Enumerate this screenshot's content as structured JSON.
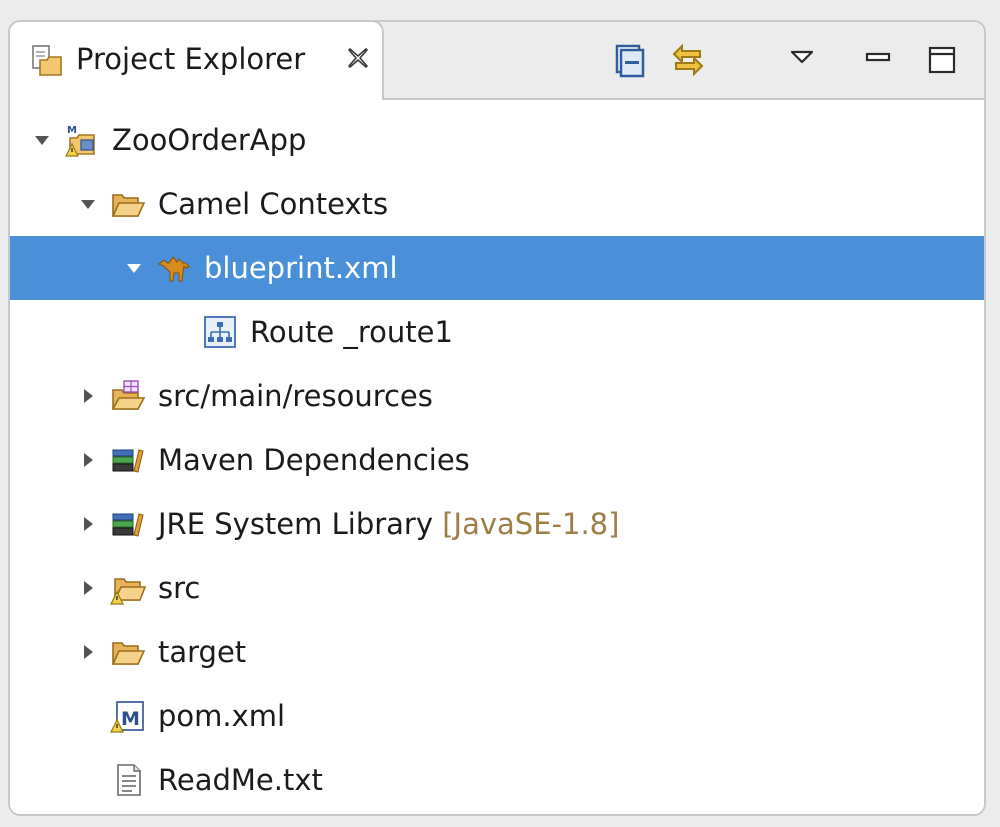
{
  "view": {
    "title": "Project Explorer",
    "toolbar": [
      "collapse-all-icon",
      "link-with-editor-icon",
      "view-menu-icon",
      "minimize-icon",
      "maximize-icon"
    ]
  },
  "tree": {
    "project": "ZooOrderApp",
    "camel_contexts": "Camel Contexts",
    "blueprint": "blueprint.xml",
    "route": "Route _route1",
    "resources": "src/main/resources",
    "maven_deps": "Maven Dependencies",
    "jre_library": "JRE System Library",
    "jre_version": "[JavaSE-1.8]",
    "src": "src",
    "target": "target",
    "pom": "pom.xml",
    "readme": "ReadMe.txt"
  },
  "colors": {
    "selection": "#4a90d9",
    "decoration": "#9c7f45",
    "folder": "#e7b25a"
  }
}
